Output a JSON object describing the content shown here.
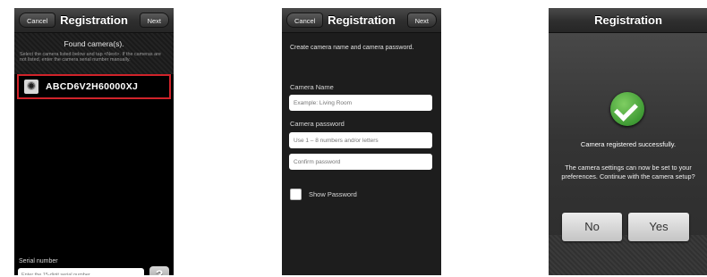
{
  "screen1": {
    "nav": {
      "cancel": "Cancel",
      "title": "Registration",
      "next": "Next"
    },
    "found_title": "Found camera(s).",
    "instructions": "Select the camera listed below and tap <Next>. If the cameras are not listed, enter the camera serial number manually.",
    "camera_name": "ABCD6V2H60000XJ",
    "serial_label": "Serial number",
    "serial_placeholder": "Enter the 15-digit serial number.",
    "help_label": "?"
  },
  "screen2": {
    "nav": {
      "cancel": "Cancel",
      "title": "Registration",
      "next": "Next"
    },
    "intro": "Create camera name and camera password.",
    "camera_name_label": "Camera Name",
    "camera_name_placeholder": "Example: Living Room",
    "password_label": "Camera password",
    "password_placeholder": "Use 1 – 8 numbers and/or letters",
    "confirm_placeholder": "Confirm password",
    "show_password_label": "Show Password",
    "show_password_checked": false
  },
  "screen3": {
    "nav": {
      "title": "Registration"
    },
    "success": "Camera registered successfully.",
    "message": "The camera settings can now be set to your preferences. Continue with the camera setup?",
    "no_label": "No",
    "yes_label": "Yes"
  },
  "colors": {
    "highlight_border": "#d0232a",
    "check_green": "#3f9a34"
  }
}
